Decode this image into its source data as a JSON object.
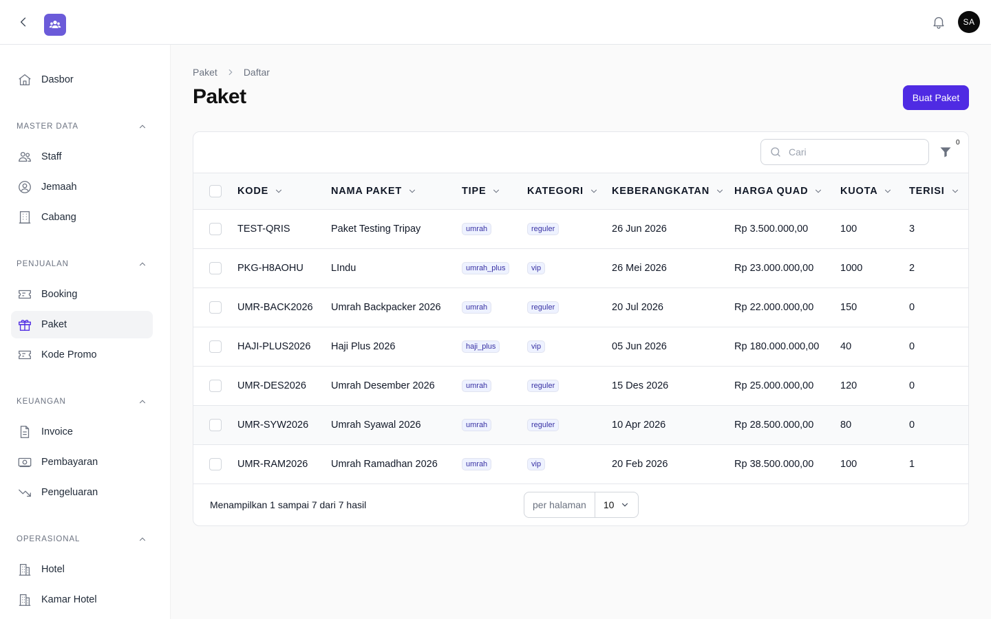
{
  "topbar": {
    "back_icon": "chevron-left-icon",
    "logo_icon": "users-logo-icon",
    "notification_icon": "bell-icon",
    "avatar_initials": "SA"
  },
  "sidebar": {
    "top_item": {
      "label": "Dasbor",
      "icon": "home-icon"
    },
    "groups": [
      {
        "title": "MASTER DATA",
        "items": [
          {
            "label": "Staff",
            "icon": "users-icon"
          },
          {
            "label": "Jemaah",
            "icon": "user-circle-icon"
          },
          {
            "label": "Cabang",
            "icon": "building-icon"
          }
        ]
      },
      {
        "title": "PENJUALAN",
        "items": [
          {
            "label": "Booking",
            "icon": "ticket-icon"
          },
          {
            "label": "Paket",
            "icon": "gift-icon",
            "active": true
          },
          {
            "label": "Kode Promo",
            "icon": "ticket-icon"
          }
        ]
      },
      {
        "title": "KEUANGAN",
        "items": [
          {
            "label": "Invoice",
            "icon": "document-icon"
          },
          {
            "label": "Pembayaran",
            "icon": "cash-icon"
          },
          {
            "label": "Pengeluaran",
            "icon": "trending-down-icon"
          }
        ]
      },
      {
        "title": "OPERASIONAL",
        "items": [
          {
            "label": "Hotel",
            "icon": "hotel-icon"
          },
          {
            "label": "Kamar Hotel",
            "icon": "hotel-icon"
          }
        ]
      }
    ]
  },
  "breadcrumb": {
    "items": [
      "Paket",
      "Daftar"
    ]
  },
  "page": {
    "title": "Paket",
    "create_button": "Buat Paket"
  },
  "table_toolbar": {
    "search_placeholder": "Cari",
    "filter_count": "0"
  },
  "table": {
    "columns": [
      "KODE",
      "NAMA PAKET",
      "TIPE",
      "KATEGORI",
      "KEBERANGKATAN",
      "HARGA QUAD",
      "KUOTA",
      "TERISI"
    ],
    "rows": [
      {
        "kode": "TEST-QRIS",
        "nama": "Paket Testing Tripay",
        "tipe": "umrah",
        "kategori": "reguler",
        "keberangkatan": "26 Jun 2026",
        "harga": "Rp 3.500.000,00",
        "kuota": "100",
        "terisi": "3"
      },
      {
        "kode": "PKG-H8AOHU",
        "nama": "LIndu",
        "tipe": "umrah_plus",
        "kategori": "vip",
        "keberangkatan": "26 Mei 2026",
        "harga": "Rp 23.000.000,00",
        "kuota": "1000",
        "terisi": "2"
      },
      {
        "kode": "UMR-BACK2026",
        "nama": "Umrah Backpacker 2026",
        "tipe": "umrah",
        "kategori": "reguler",
        "keberangkatan": "20 Jul 2026",
        "harga": "Rp 22.000.000,00",
        "kuota": "150",
        "terisi": "0"
      },
      {
        "kode": "HAJI-PLUS2026",
        "nama": "Haji Plus 2026",
        "tipe": "haji_plus",
        "kategori": "vip",
        "keberangkatan": "05 Jun 2026",
        "harga": "Rp 180.000.000,00",
        "kuota": "40",
        "terisi": "0"
      },
      {
        "kode": "UMR-DES2026",
        "nama": "Umrah Desember 2026",
        "tipe": "umrah",
        "kategori": "reguler",
        "keberangkatan": "15 Des 2026",
        "harga": "Rp 25.000.000,00",
        "kuota": "120",
        "terisi": "0"
      },
      {
        "kode": "UMR-SYW2026",
        "nama": "Umrah Syawal 2026",
        "tipe": "umrah",
        "kategori": "reguler",
        "keberangkatan": "10 Apr 2026",
        "harga": "Rp 28.500.000,00",
        "kuota": "80",
        "terisi": "0"
      },
      {
        "kode": "UMR-RAM2026",
        "nama": "Umrah Ramadhan 2026",
        "tipe": "umrah",
        "kategori": "vip",
        "keberangkatan": "20 Feb 2026",
        "harga": "Rp 38.500.000,00",
        "kuota": "100",
        "terisi": "1"
      }
    ]
  },
  "pagination": {
    "summary": "Menampilkan 1 sampai 7 dari 7 hasil",
    "per_page_label": "per halaman",
    "per_page_value": "10"
  },
  "colors": {
    "accent": "#4f2be3",
    "logo": "#6b5bd9",
    "badge_bg": "#eef2ff",
    "badge_text": "#3730a3"
  }
}
